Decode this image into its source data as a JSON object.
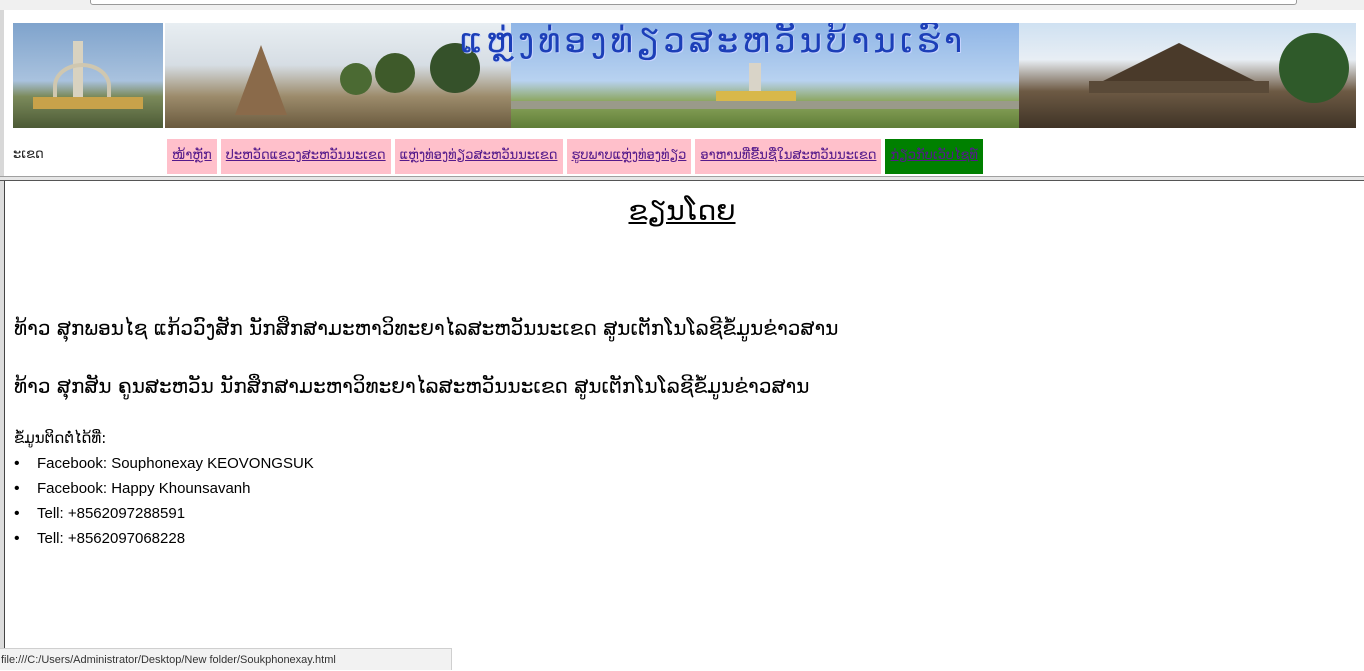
{
  "banner": {
    "title": "ແຫຼ່ງທ່ອງທ່ຽວສະຫວັນບ້ານເຮົາ"
  },
  "header": {
    "site_label": "ະເຂດ"
  },
  "nav": {
    "items": [
      {
        "label": "ໜ້າຫຼັກ",
        "active": false
      },
      {
        "label": "ປະຫວັດແຂວງສະຫວັນນະເຂດ",
        "active": false
      },
      {
        "label": "ແຫຼ່ງທ່ອງທ່ຽວສະຫວັນນະເຂດ",
        "active": false
      },
      {
        "label": "ຮູບພາບແຫຼ່ງທ່ອງທ່ຽວ",
        "active": false
      },
      {
        "label": "ອາຫານທີ່ຂື້ນຊື່ໃນສະຫວັນນະເຂດ",
        "active": false
      },
      {
        "label": "ກ່ຽວກັບເວັບໄຊທ໌",
        "active": true
      }
    ],
    "colors": {
      "item_bg": "#ffc0cb",
      "active_bg": "#008000",
      "link": "#551a8b"
    }
  },
  "content": {
    "heading": "ຂຽນໂດຍ",
    "authors": [
      "ທ້າວ ສຸກພອນໄຊ ແກ້ວວົງສັກ ນັກສຶກສາມະຫາວິທະຍາໄລສະຫວັນນະເຂດ ສູນເຕັກໂນໂລຊີຂໍ້ມູນຂ່າວສານ",
      "ທ້າວ ສຸກສັນ ຄູນສະຫວັນ ນັກສຶກສາມະຫາວິທະຍາໄລສະຫວັນນະເຂດ ສູນເຕັກໂນໂລຊີຂໍ້ມູນຂ່າວສານ"
    ],
    "contact_label": "ຂໍ້ມູນຕິດຕໍ່ໄດ້ທີ່:",
    "contacts": [
      "Facebook: Souphonexay KEOVONGSUK",
      "Facebook: Happy Khounsavanh",
      "Tell: +8562097288591",
      "Tell: +8562097068228"
    ]
  },
  "status_bar": {
    "url": "file:///C:/Users/Administrator/Desktop/New folder/Soukphonexay.html"
  }
}
